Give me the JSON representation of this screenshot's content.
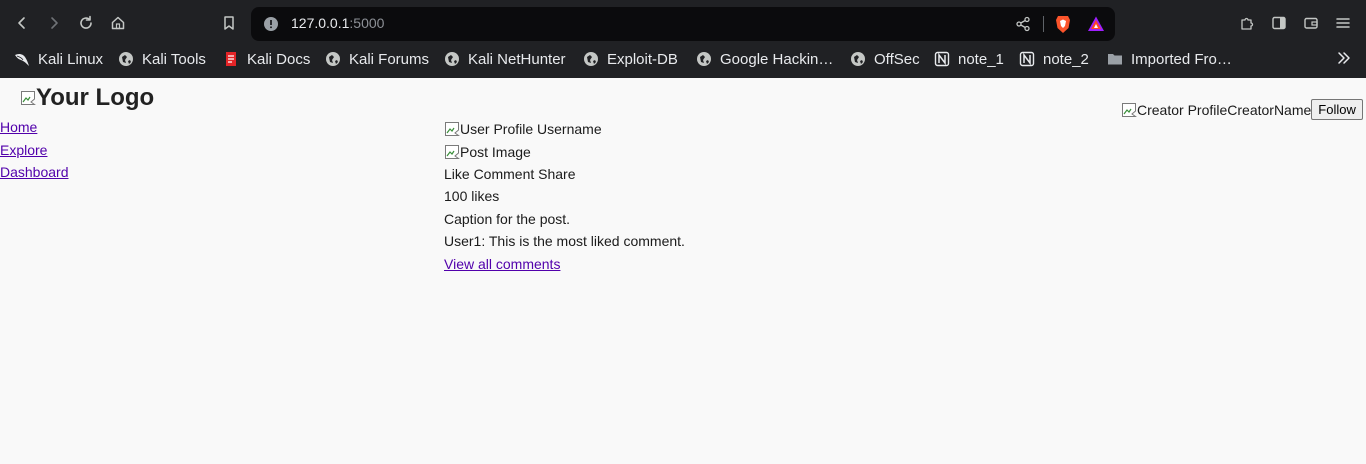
{
  "browser": {
    "url_host": "127.0.0.1",
    "url_port": ":5000",
    "bookmarks": [
      {
        "label": "Kali Linux",
        "icon": "kali-dragon-icon"
      },
      {
        "label": "Kali Tools",
        "icon": "globe-icon"
      },
      {
        "label": "Kali Docs",
        "icon": "kali-docs-icon"
      },
      {
        "label": "Kali Forums",
        "icon": "globe-icon"
      },
      {
        "label": "Kali NetHunter",
        "icon": "globe-icon"
      },
      {
        "label": "Exploit-DB",
        "icon": "globe-icon"
      },
      {
        "label": "Google Hackin…",
        "icon": "globe-icon"
      },
      {
        "label": "OffSec",
        "icon": "globe-icon"
      },
      {
        "label": "note_1",
        "icon": "notion-icon"
      },
      {
        "label": "note_2",
        "icon": "notion-icon"
      },
      {
        "label": "Imported Fro…",
        "icon": "folder-icon"
      }
    ],
    "colors": {
      "chrome_bg": "#202124",
      "urlbar_bg": "#0b0b0d",
      "text": "#e8eaed",
      "brave_orange": "#fb542b"
    }
  },
  "page": {
    "logo_alt": "Your Logo",
    "nav": {
      "home": "Home",
      "explore": "Explore",
      "dashboard": "Dashboard"
    },
    "post": {
      "profile_alt": "User Profile",
      "username": " Username",
      "image_alt": "Post Image",
      "actions": "Like Comment Share",
      "likes": "100 likes",
      "caption": "Caption for the post.",
      "top_comment": "User1: This is the most liked comment.",
      "view_comments": "View all comments"
    },
    "creator": {
      "profile_alt": "Creator Profile",
      "name": "CreatorName",
      "follow_label": "Follow"
    },
    "colors": {
      "link": "#5100ab",
      "bg": "#f9f9f9"
    }
  }
}
